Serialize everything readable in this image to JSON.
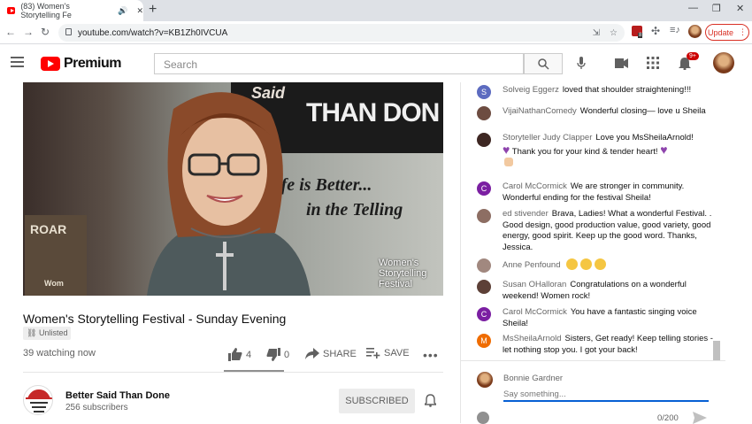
{
  "browser": {
    "tab_title": "(83) Women's Storytelling Fe",
    "url": "youtube.com/watch?v=KB1Zh0IVCUA",
    "update_label": "Update",
    "extension_badge": "8"
  },
  "header": {
    "logo_text": "Premium",
    "search_placeholder": "Search",
    "notification_count": "9+"
  },
  "video": {
    "banner_said": "Said",
    "banner_than": "THAN DON",
    "wall_line1": "e Life is Better...",
    "wall_line2": "in the Telling",
    "book_title": "ROAR",
    "book_sub": "Wom",
    "watermark": [
      "Women's",
      "Storytelling",
      "Festival"
    ],
    "title": "Women's Storytelling Festival - Sunday Evening",
    "unlisted_label": "Unlisted",
    "watching": "39 watching now",
    "likes": "4",
    "dislikes": "0",
    "share_label": "SHARE",
    "save_label": "SAVE"
  },
  "channel": {
    "name": "Better Said Than Done",
    "subscribers": "256 subscribers",
    "subscribed_label": "SUBSCRIBED"
  },
  "chat": {
    "messages": [
      {
        "author": "Solveig Eggerz",
        "text": "loved that shoulder straightening!!!",
        "initial": "S",
        "color": "#5c6bc0"
      },
      {
        "author": "VijaiNathanComedy",
        "text": "Wonderful closing— love u Sheila",
        "initial": "",
        "color": "#6d4c41"
      },
      {
        "author": "Storyteller Judy Clapper",
        "text": "Love you MsSheilaArnold!",
        "text2": "Thank you for your kind & tender heart!",
        "initial": "",
        "color": "#3e2723"
      },
      {
        "author": "Carol McCormick",
        "text": "We are stronger in community. Wonderful ending for the festival Sheila!",
        "initial": "C",
        "color": "#7b1fa2"
      },
      {
        "author": "ed stivender",
        "text": "Brava, Ladies! What a wonderful Festival. . Good design, good production value, good variety, good energy, good spirit. Keep up the good word. Thanks, Jessica.",
        "initial": "",
        "color": "#8d6e63"
      },
      {
        "author": "Anne Penfound",
        "text": "",
        "initial": "",
        "color": "#a1887f"
      },
      {
        "author": "Susan OHalloran",
        "text": "Congratulations on a wonderful weekend! Women rock!",
        "initial": "",
        "color": "#5d4037"
      },
      {
        "author": "Carol McCormick",
        "text": "You have a fantastic singing voice Sheila!",
        "initial": "C",
        "color": "#7b1fa2"
      },
      {
        "author": "MsSheilaArnold",
        "text": "Sisters, Get ready! Keep telling stories - let nothing stop you. I got your back!",
        "initial": "M",
        "color": "#ef6c00"
      }
    ],
    "input_author": "Bonnie Gardner",
    "input_placeholder": "Say something...",
    "char_count": "0/200"
  }
}
